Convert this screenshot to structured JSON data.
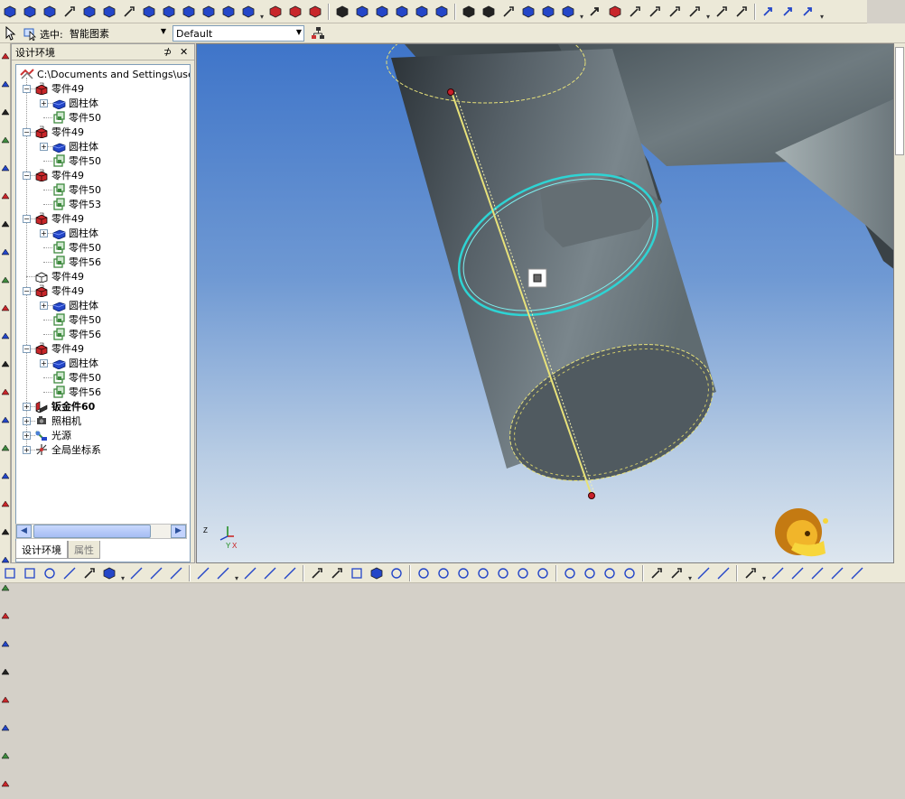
{
  "toolbar_row2": {
    "select_label": "选中:",
    "select_value": "智能图素",
    "style_value": "Default"
  },
  "panel": {
    "title": "设计环境",
    "pin_glyph": "⊅",
    "close_glyph": "✕",
    "tabs": [
      {
        "label": "设计环境",
        "active": true
      },
      {
        "label": "属性",
        "active": false
      }
    ]
  },
  "tree": {
    "root": "C:\\Documents and Settings\\user\\桌",
    "nodes": [
      {
        "label": "零件49",
        "depth": 1,
        "exp": "−",
        "icon": "part-red-icon"
      },
      {
        "label": "圆柱体",
        "depth": 2,
        "exp": "+",
        "icon": "cylinder-blue-icon"
      },
      {
        "label": "零件50",
        "depth": 2,
        "exp": "",
        "icon": "part-green-icon"
      },
      {
        "label": "零件49",
        "depth": 1,
        "exp": "−",
        "icon": "part-red-icon"
      },
      {
        "label": "圆柱体",
        "depth": 2,
        "exp": "+",
        "icon": "cylinder-blue-icon"
      },
      {
        "label": "零件50",
        "depth": 2,
        "exp": "",
        "icon": "part-green-icon"
      },
      {
        "label": "零件49",
        "depth": 1,
        "exp": "−",
        "icon": "part-red-icon"
      },
      {
        "label": "零件50",
        "depth": 2,
        "exp": "",
        "icon": "part-green-icon"
      },
      {
        "label": "零件53",
        "depth": 2,
        "exp": "",
        "icon": "part-green-icon"
      },
      {
        "label": "零件49",
        "depth": 1,
        "exp": "−",
        "icon": "part-red-icon"
      },
      {
        "label": "圆柱体",
        "depth": 2,
        "exp": "+",
        "icon": "cylinder-blue-icon"
      },
      {
        "label": "零件50",
        "depth": 2,
        "exp": "",
        "icon": "part-green-icon"
      },
      {
        "label": "零件56",
        "depth": 2,
        "exp": "",
        "icon": "part-green-icon"
      },
      {
        "label": "零件49",
        "depth": 1,
        "exp": "",
        "icon": "part-outline-icon"
      },
      {
        "label": "零件49",
        "depth": 1,
        "exp": "−",
        "icon": "part-red-icon"
      },
      {
        "label": "圆柱体",
        "depth": 2,
        "exp": "+",
        "icon": "cylinder-blue-icon"
      },
      {
        "label": "零件50",
        "depth": 2,
        "exp": "",
        "icon": "part-green-icon"
      },
      {
        "label": "零件56",
        "depth": 2,
        "exp": "",
        "icon": "part-green-icon"
      },
      {
        "label": "零件49",
        "depth": 1,
        "exp": "−",
        "icon": "part-red-icon"
      },
      {
        "label": "圆柱体",
        "depth": 2,
        "exp": "+",
        "icon": "cylinder-blue-icon"
      },
      {
        "label": "零件50",
        "depth": 2,
        "exp": "",
        "icon": "part-green-icon"
      },
      {
        "label": "零件56",
        "depth": 2,
        "exp": "",
        "icon": "part-green-icon"
      },
      {
        "label": "钣金件60",
        "depth": 1,
        "exp": "+",
        "icon": "sheetmetal-icon",
        "bold": true
      },
      {
        "label": "照相机",
        "depth": 1,
        "exp": "+",
        "icon": "camera-icon"
      },
      {
        "label": "光源",
        "depth": 1,
        "exp": "+",
        "icon": "light-icon"
      },
      {
        "label": "全局坐标系",
        "depth": 1,
        "exp": "+",
        "icon": "coord-icon"
      }
    ]
  },
  "viewport": {
    "axis_labels": {
      "z": "Z",
      "y": "Y",
      "x": "X"
    }
  },
  "colors": {
    "part_red": "#c8262a",
    "part_green": "#3f8a3f",
    "cylinder_blue": "#2446c8",
    "selection_cyan": "#2ed4d4",
    "edge_yellow": "#e8e27a"
  }
}
